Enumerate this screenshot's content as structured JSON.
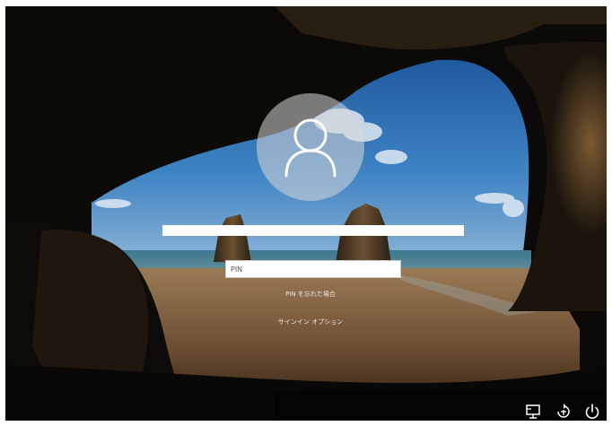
{
  "login": {
    "pin_placeholder": "PIN",
    "forgot_pin_label": "PIN を忘れた場合",
    "signin_options_label": "サインイン オプション"
  },
  "icons": {
    "avatar": "user-icon",
    "network": "network-icon",
    "ease_of_access": "ease-of-access-icon",
    "power": "power-icon"
  },
  "colors": {
    "sky": "#2f6fb3",
    "sea": "#3f7c93",
    "sand": "#8a6642",
    "cave": "#0b0a08",
    "avatar_circle": "#d7d7d7"
  }
}
